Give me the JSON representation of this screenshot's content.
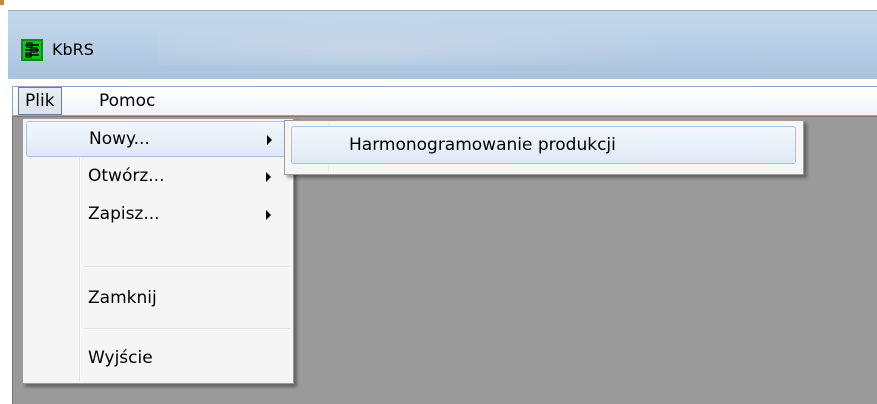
{
  "window": {
    "title": "KbRS",
    "icon": "app-grid-icon",
    "accent": "#10c020"
  },
  "menubar": {
    "items": [
      {
        "label": "Plik",
        "state": "open"
      },
      {
        "label": "Pomoc"
      }
    ]
  },
  "file_menu": {
    "items": [
      {
        "label": "Nowy...",
        "submenu": true,
        "state": "hover"
      },
      {
        "label": "Otwórz...",
        "submenu": true
      },
      {
        "label": "Zapisz...",
        "submenu": true
      },
      {
        "label": "Zamknij",
        "submenu": false
      },
      {
        "label": "Wyjście",
        "submenu": false
      }
    ]
  },
  "new_submenu": {
    "items": [
      {
        "label": "Harmonogramowanie produkcji",
        "state": "hover"
      }
    ]
  },
  "colors": {
    "client_area": "#9a9a9a",
    "menu_bg": "#f5f5f5",
    "highlight_border": "#a8c3e0"
  }
}
